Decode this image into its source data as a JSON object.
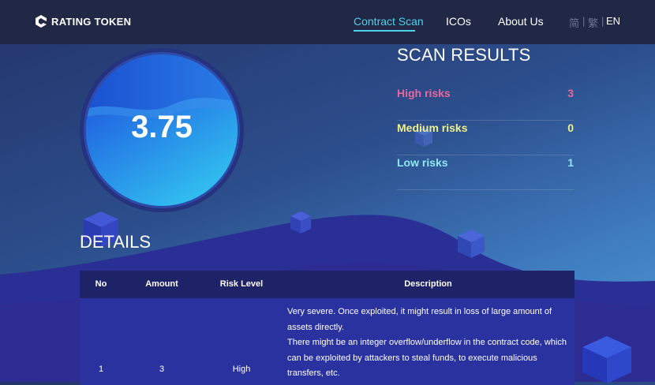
{
  "brand": {
    "name": "RATING TOKEN"
  },
  "nav": {
    "items": [
      "Contract Scan",
      "ICOs",
      "About Us"
    ],
    "active": "Contract Scan",
    "lang": {
      "simplified": "简",
      "traditional": "繁",
      "english": "EN",
      "separator": "|"
    }
  },
  "score": {
    "value": "3.75"
  },
  "scan_results": {
    "title": "SCAN RESULTS",
    "items": [
      {
        "label": "High risks",
        "count": "3",
        "color": "#e9669f"
      },
      {
        "label": "Medium risks",
        "count": "0",
        "color": "#eef08a"
      },
      {
        "label": "Low risks",
        "count": "1",
        "color": "#8fe7f4"
      }
    ]
  },
  "details": {
    "title": "DETAILS",
    "columns": [
      "No",
      "Amount",
      "Risk Level",
      "Description"
    ],
    "rows": [
      {
        "no": "1",
        "amount": "3",
        "risk_level": "High",
        "description_lines": [
          "Very severe. Once exploited, it might result in loss of large amount of",
          "assets directly.",
          "There might be an integer overflow/underflow in the contract code, which",
          "can be exploited by attackers to steal funds, to execute malicious",
          "transfers, etc."
        ]
      }
    ]
  },
  "colors": {
    "navbar": "#212846",
    "accent": "#4fd0ea",
    "table_header": "#1e2266",
    "table_row": "#2a32a0"
  }
}
